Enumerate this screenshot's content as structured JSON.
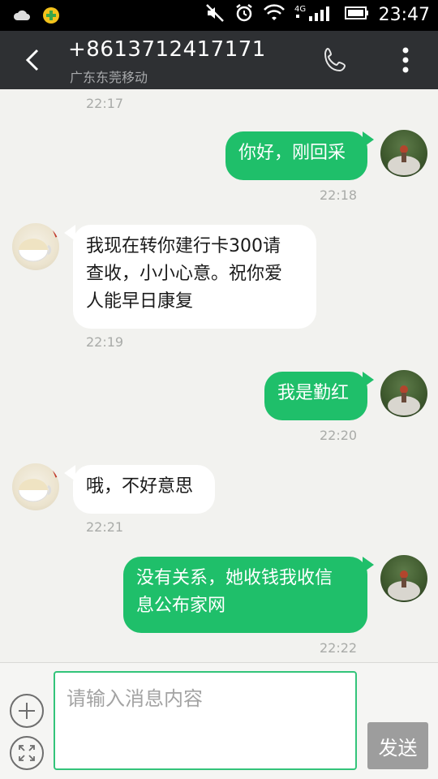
{
  "status_bar": {
    "time": "23:47",
    "network": "4G",
    "icons": [
      "cloud-icon",
      "app-notification-icon",
      "mute-icon",
      "alarm-icon",
      "wifi-icon",
      "signal-icon",
      "battery-icon"
    ]
  },
  "header": {
    "phone_number": "+8613712417171",
    "carrier": "广东东莞移动",
    "icons": [
      "back-icon",
      "phone-icon",
      "more-vertical-icon"
    ]
  },
  "messages": [
    {
      "direction": "in",
      "timestamp": "22:17",
      "text": null
    },
    {
      "direction": "out",
      "text": "你好，刚回采",
      "timestamp": "22:18"
    },
    {
      "direction": "in",
      "text_lines": [
        "我现在转你建行卡300请",
        "查收，小小心意。祝你爱",
        "人能早日康复"
      ],
      "timestamp": "22:19"
    },
    {
      "direction": "out",
      "text": "我是勤红",
      "timestamp": "22:20"
    },
    {
      "direction": "in",
      "text": "哦，不好意思",
      "timestamp": "22:21"
    },
    {
      "direction": "out",
      "text_lines": [
        "没有关系，她收钱我收信",
        "息公布家网"
      ],
      "timestamp": "22:22"
    }
  ],
  "input_bar": {
    "placeholder": "请输入消息内容",
    "value": "",
    "send_label": "发送",
    "icons": [
      "add-icon",
      "expand-icon"
    ]
  },
  "colors": {
    "outgoing_bubble": "#1fbf6a",
    "incoming_bubble": "#ffffff",
    "header_bg": "#2e3033",
    "chat_bg": "#f2f2ef",
    "send_button": "#9d9d9d"
  }
}
